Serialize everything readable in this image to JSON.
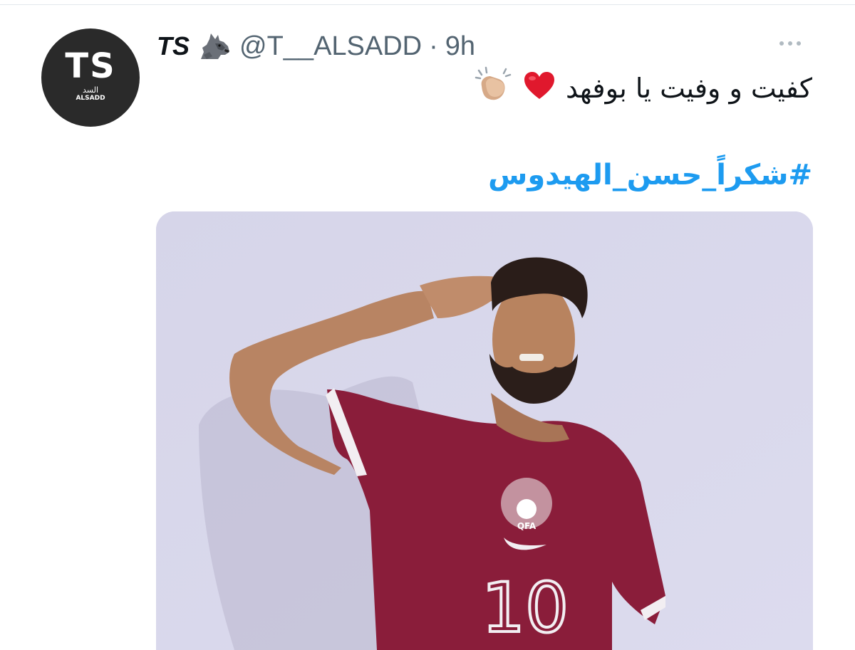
{
  "tweet": {
    "author": {
      "display_name": "TS",
      "emoji_icon": "wolf-icon",
      "handle": "@T__ALSADD",
      "separator": "·",
      "time": "9h",
      "avatar": {
        "logo_letters": "TS",
        "logo_arabic": "السد",
        "logo_english": "ALSADD"
      }
    },
    "text": "كفيت و وفيت يا بوفهد",
    "text_emojis": [
      "red-heart-icon",
      "clapping-hands-icon"
    ],
    "hashtag": "#شكراً_حسن_الهيدوس",
    "media": {
      "jersey_number": "10",
      "crest_text": "QFA"
    }
  },
  "colors": {
    "text_primary": "#0f1419",
    "text_secondary": "#536471",
    "link": "#1d9bf0",
    "jersey": "#8a1d3a",
    "background_wall": "#d8d7ea"
  }
}
